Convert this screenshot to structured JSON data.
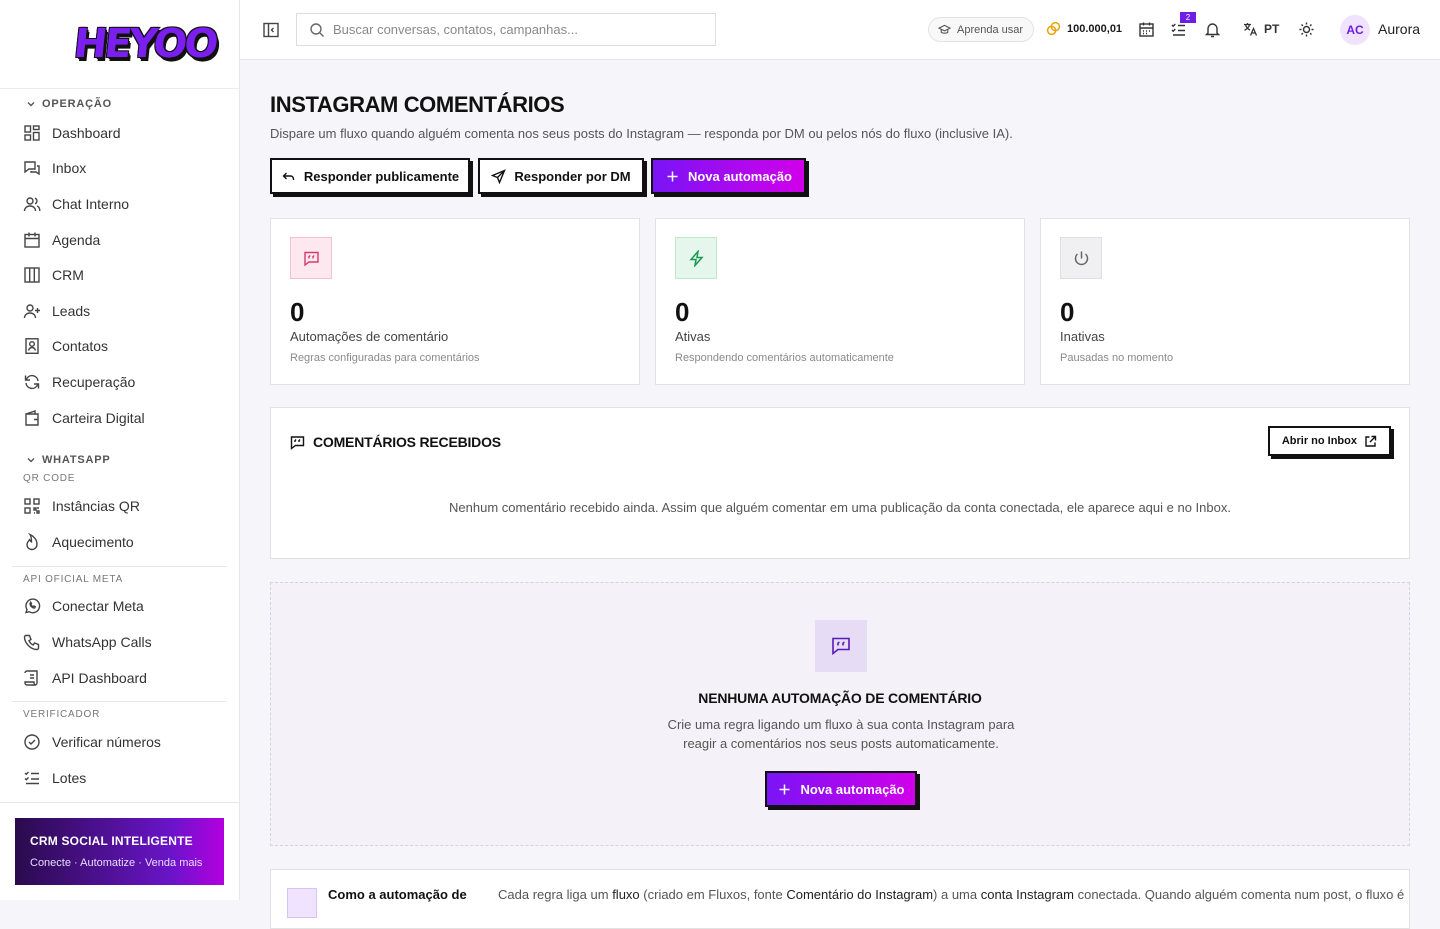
{
  "app": {
    "logo_text": "HEYOO"
  },
  "sidebar": {
    "section_operacao": "OPERAÇÃO",
    "operacao_items": [
      {
        "label": "Dashboard",
        "icon": "dashboard-icon"
      },
      {
        "label": "Inbox",
        "icon": "inbox-icon"
      },
      {
        "label": "Chat Interno",
        "icon": "users-icon"
      },
      {
        "label": "Agenda",
        "icon": "calendar-icon"
      },
      {
        "label": "CRM",
        "icon": "columns-icon"
      },
      {
        "label": "Leads",
        "icon": "user-plus-icon"
      },
      {
        "label": "Contatos",
        "icon": "contacts-icon"
      },
      {
        "label": "Recuperação",
        "icon": "refresh-icon"
      },
      {
        "label": "Carteira Digital",
        "icon": "wallet-icon"
      }
    ],
    "section_whatsapp": "WHATSAPP",
    "sub_qr": "QR CODE",
    "qr_items": [
      {
        "label": "Instâncias QR",
        "icon": "qr-icon"
      },
      {
        "label": "Aquecimento",
        "icon": "flame-icon"
      }
    ],
    "sub_meta": "API OFICIAL META",
    "meta_items": [
      {
        "label": "Conectar Meta",
        "icon": "whatsapp-icon"
      },
      {
        "label": "WhatsApp Calls",
        "icon": "phone-icon"
      },
      {
        "label": "API Dashboard",
        "icon": "scroll-icon"
      }
    ],
    "sub_verificador": "VERIFICADOR",
    "verificador_items": [
      {
        "label": "Verificar números",
        "icon": "check-circle-icon"
      },
      {
        "label": "Lotes",
        "icon": "list-check-icon"
      }
    ],
    "promo": {
      "title": "CRM SOCIAL INTELIGENTE",
      "subtitle": "Conecte · Automatize · Venda mais"
    }
  },
  "topbar": {
    "search_placeholder": "Buscar conversas, contatos, campanhas...",
    "learn_label": "Aprenda usar",
    "coins": "100.000,01",
    "tasks_badge": "2",
    "language": "PT",
    "avatar_initials": "AC",
    "user_name": "Aurora"
  },
  "page": {
    "title": "INSTAGRAM COMENTÁRIOS",
    "subtitle": "Dispare um fluxo quando alguém comenta nos seus posts do Instagram — responda por DM ou pelos nós do fluxo (inclusive IA).",
    "btn_public": "Responder publicamente",
    "btn_dm": "Responder por DM",
    "btn_new": "Nova automação",
    "stats": [
      {
        "value": "0",
        "label": "Automações de comentário",
        "hint": "Regras configuradas para comentários"
      },
      {
        "value": "0",
        "label": "Ativas",
        "hint": "Respondendo comentários automaticamente"
      },
      {
        "value": "0",
        "label": "Inativas",
        "hint": "Pausadas no momento"
      }
    ],
    "comments": {
      "title": "COMENTÁRIOS RECEBIDOS",
      "inbox_btn": "Abrir no Inbox",
      "empty": "Nenhum comentário recebido ainda. Assim que alguém comentar em uma publicação da conta conectada, ele aparece aqui e no Inbox."
    },
    "empty_auto": {
      "title": "NENHUMA AUTOMAÇÃO DE COMENTÁRIO",
      "desc": "Crie uma regra ligando um fluxo à sua conta Instagram para reagir a comentários nos seus posts automaticamente.",
      "btn": "Nova automação"
    },
    "how": {
      "title": "Como a automação de",
      "desc_1": "Cada regra liga um",
      "desc_2": "fluxo",
      "desc_3": "(criado em Fluxos, fonte",
      "desc_4": "Comentário do Instagram",
      "desc_5": ") a uma",
      "desc_6": "conta Instagram",
      "desc_7": "conectada. Quando alguém comenta num post, o fluxo é"
    }
  },
  "colors": {
    "accent": "#6d1de6",
    "accent_pink": "#d100ea"
  }
}
